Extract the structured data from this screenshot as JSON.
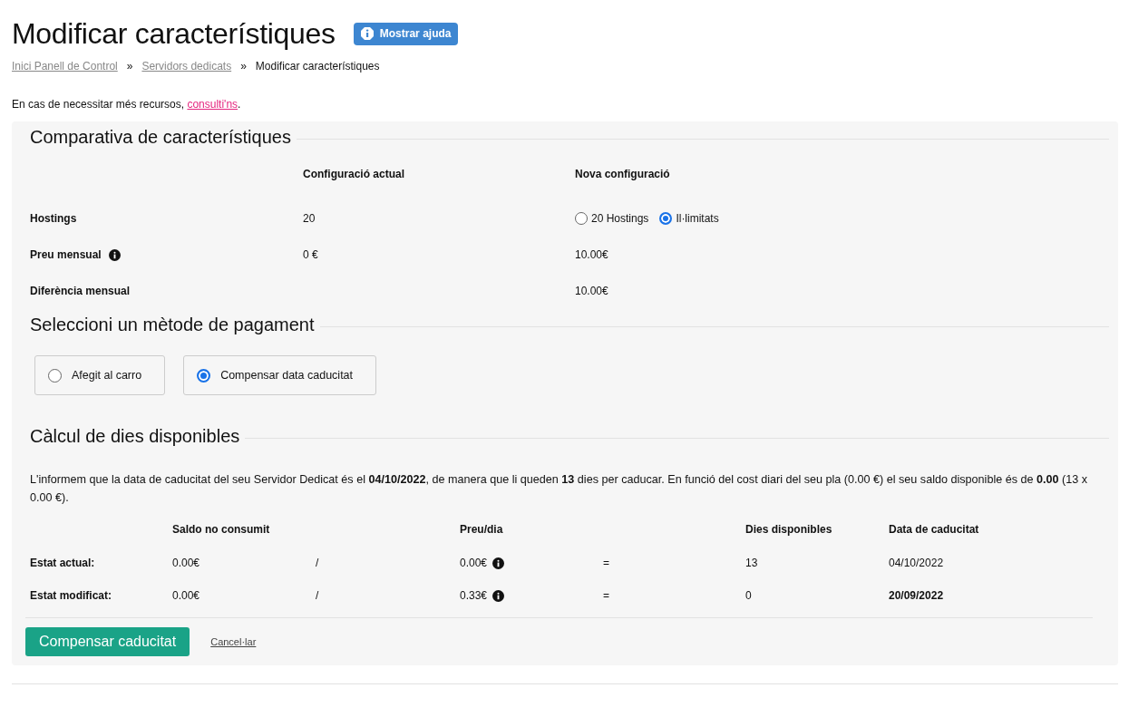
{
  "page": {
    "title": "Modificar característiques",
    "help_button": "Mostrar ajuda"
  },
  "breadcrumb": [
    {
      "label": "Inici Panell de Control",
      "link": true
    },
    {
      "label": "Servidors dedicats",
      "link": true
    },
    {
      "label": "Modificar característiques",
      "link": false
    }
  ],
  "breadcrumb_separator": "»",
  "intro": {
    "text": "En cas de necessitar més recursos, ",
    "link": "consulti'ns",
    "end": "."
  },
  "comparison": {
    "title": "Comparativa de característiques",
    "columns": [
      "Configuració actual",
      "Nova configuració"
    ],
    "rows": [
      {
        "kind": "options",
        "label": "Hostings",
        "info": false,
        "current": "20",
        "options": [
          {
            "label": "20 Hostings",
            "selected": false
          },
          {
            "label": "Il·limitats",
            "selected": true
          }
        ]
      },
      {
        "kind": "text",
        "label": "Preu mensual",
        "info": true,
        "current": "0 €",
        "new": "10.00€"
      },
      {
        "kind": "text",
        "label": "Diferència mensual",
        "info": false,
        "current": "",
        "new": "10.00€"
      }
    ]
  },
  "payment": {
    "title": "Seleccioni un mètode de pagament",
    "options": [
      {
        "label": "Afegit al carro",
        "selected": false
      },
      {
        "label": "Compensar data caducitat",
        "selected": true
      }
    ]
  },
  "calc": {
    "title": "Càlcul de dies disponibles",
    "description": "L'informem que la data de caducitat del seu Servidor Dedicat és el **04/10/2022**, de manera que li queden **13** dies per caducar. En funció del cost diari del seu pla (0.00 €) el seu saldo disponible és de **0.00** (13 x 0.00 €).",
    "columns": [
      "Saldo no consumit",
      "Preu/dia",
      "Dies disponibles",
      "Data de caducitat"
    ],
    "rows": [
      {
        "label": "Estat actual:",
        "balance": "0.00€",
        "divide": "/",
        "price": "0.00€",
        "equals": "=",
        "days": "13",
        "date": "04/10/2022",
        "date_bold": false
      },
      {
        "label": "Estat modificat:",
        "balance": "0.00€",
        "divide": "/",
        "price": "0.33€",
        "equals": "=",
        "days": "0",
        "date": "20/09/2022",
        "date_bold": true
      }
    ]
  },
  "actions": {
    "submit": "Compensar caducitat",
    "cancel": "Cancel·lar"
  }
}
